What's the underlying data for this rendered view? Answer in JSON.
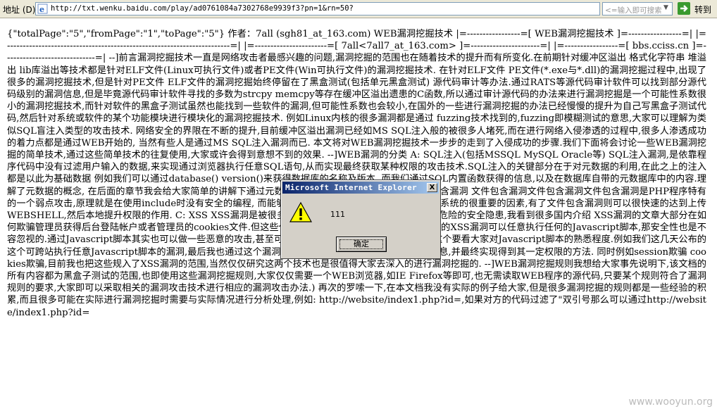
{
  "addressbar": {
    "label": "地址 (D)",
    "url": "http://txt.wenku.baidu.com/play/ad0761084a7302768e9939f3?pn=1&rn=50?",
    "search_placeholder": "<=输入即可搜索",
    "go_label": "转到"
  },
  "page_text": "{\"totalPage\":\"5\",\"fromPage\":\"1\",\"toPage\":\"5\"} 作者：7all (sgh81_at_163.com) WEB漏洞挖掘技术 |=-----------------=[ WEB漏洞挖掘技术 ]=-----------------=| |=-----------------------------------------------------------------------=| |=-----------------------=[ 7all<7all7_at_163.com> ]=----------------------=| |=-----------------=[ bbs.cciss.cn ]=-----------------------------=| --]前言漏洞挖掘技术一直是网络攻击者最感兴趣的问题,漏洞挖掘的范围也在随着技术的提升而有所变化.在前期针对缓冲区溢出 格式化字符串 堆溢出 lib库溢出等技术都是针对ELF文件(Linux可执行文件)或者PE文件(Win可执行文件)的漏洞挖掘技术. 在针对ELF文件 PE文件(*.exe与*.dll)的漏洞挖掘过程中,出现了很多的漏洞挖掘技术,但是针对PE文件 ELF文件的漏洞挖掘始终停留在了黑盒测试(包括单元黑盒测试) 源代码审计等办法.通过RATS等源代码审计软件可以找到部分源代码级别的漏洞信息,但是毕竟源代码审计软件寻找的多数为strcpy memcpy等存在缓冲区溢出遗患的C函数,所以通过审计源代码的办法来进行漏洞挖掘是一个可能性系数很小的漏洞挖掘技术,而针对软件的黑盒子测试虽然也能找到一些软件的漏洞,但可能性系数也会较小,在国外的一些进行漏洞挖掘的办法已经慢慢的提升为自己写黑盒子测试代码,然后针对系统或软件的某个功能模块进行模块化的漏洞挖掘技术. 例如Linux内核的很多漏洞都是通过 fuzzing技术找到的,fuzzing即模糊测试的意思,大家可以理解为类似SQL盲注入类型的攻击技术. 网络安全的界限在不断的提升,目前缓冲区溢出漏洞已经如MS SQL注入般的被很多人堵死,而在进行网络入侵渗透的过程中,很多人渗透成功的着力点都是通过WEB开始的, 当然有些人是通过MS SQL注入漏洞而已. 本文将对WEB漏洞挖掘技术一步步的走到了入侵成功的步骤.我们下面将会讨论一些WEB漏洞挖掘的简单技术,通过这些简单技术的往复使用,大家或许会得到意想不到的效果. --]WEB漏洞的分类 A: SQL注入(包括MSSQL MySQL Oracle等) SQL注入漏洞,是依靠程序代码中没有过滤用户输入的数据,来实现通过浏览器执行任意SQL语句,从而实现最终获取某种权限的攻击技术.SQL注入的关键部分在于对元数据的利用,在此之上的注入都是以此为基础数据 例如我们可以通过database() version()来获得数据库的名称及版本, 而我们通过SQL内置函数获得的信息,以及在数据库自带的元数据库中的内容.理解了元数据的概念, 在后面的章节我会给大家简单的讲解下通过元数据来获取MySQL的数据表. B: 文件包含漏洞 文件包含漏洞文件包含漏洞文件包含漏洞是PHP程序特有的一个弱点攻击,原理就是在使用include时没有安全的编程, 而能够找到文件包含漏洞则是入侵一个WEB系统的很重要的因素,有了文件包含漏洞则可以很快速的达到上传WEBSHELL,然后本地提升权限的作用. C: XSS XSS漏洞是被很多人遗忘的漏洞,但是XSS也是一个比较危险的安全隐患,我看到很多国内介绍 XSS漏洞的文章大部分在如何欺骗管理员获得后台登陆帐户或者管理员的cookies文件.但这些仅仅是XSS漏洞的简单用法,如果寻找到的XSS漏洞可以任意执行任何的Javascript脚本,那安全性也是不容忽视的.通过Javascript脚本其实也可以做一些恶意的攻击,甚至可以获得一些WEB 程序的源代码,当然这个要看大家对Javascript脚本的熟悉程度.例如我们这几天公布的这个可跨站执行任意Javascript脚本的漏洞,最后我也通过这个漏洞给客户演示了如何获取他们的服务器信息,并最终实现得到其一定权限的方法. 同时例如session欺骗 cookies欺骗,目前我也把这些规入了XSS漏洞的范围,当然仅仅研究这两个技术也是很值得大家去深入的进行漏洞挖掘的. --]WEB漏洞挖掘规则我想给大家事先说明下,该文档的所有内容都为黑盒子测试的范围,也即使用这些漏洞挖掘规则,大家仅仅需要一个WEB浏览器,如IE Firefox等即可,也无需读取WEB程序的源代码,只要某个规则符合了漏洞规则的要求,大家即可以采取相关的漏洞攻击技术进行相应的漏洞攻击办法.) 再次的罗嗦一下,在本文档我没有实际的例子给大家,但是很多漏洞挖掘的规则都是一些经验的积累,而且很多可能在实际进行漏洞挖掘时需要与实际情况进行分析处理,例如: http://website/index1.php?id=,如果对方的代码过滤了\"双引号那么可以通过http://website/index1.php?id=",
  "dialog": {
    "title": "Microsoft Internet Explorer",
    "close": "X",
    "message": "111",
    "ok_label": "确定",
    "icon": "warning-icon"
  },
  "watermark": "www.wooyun.org"
}
